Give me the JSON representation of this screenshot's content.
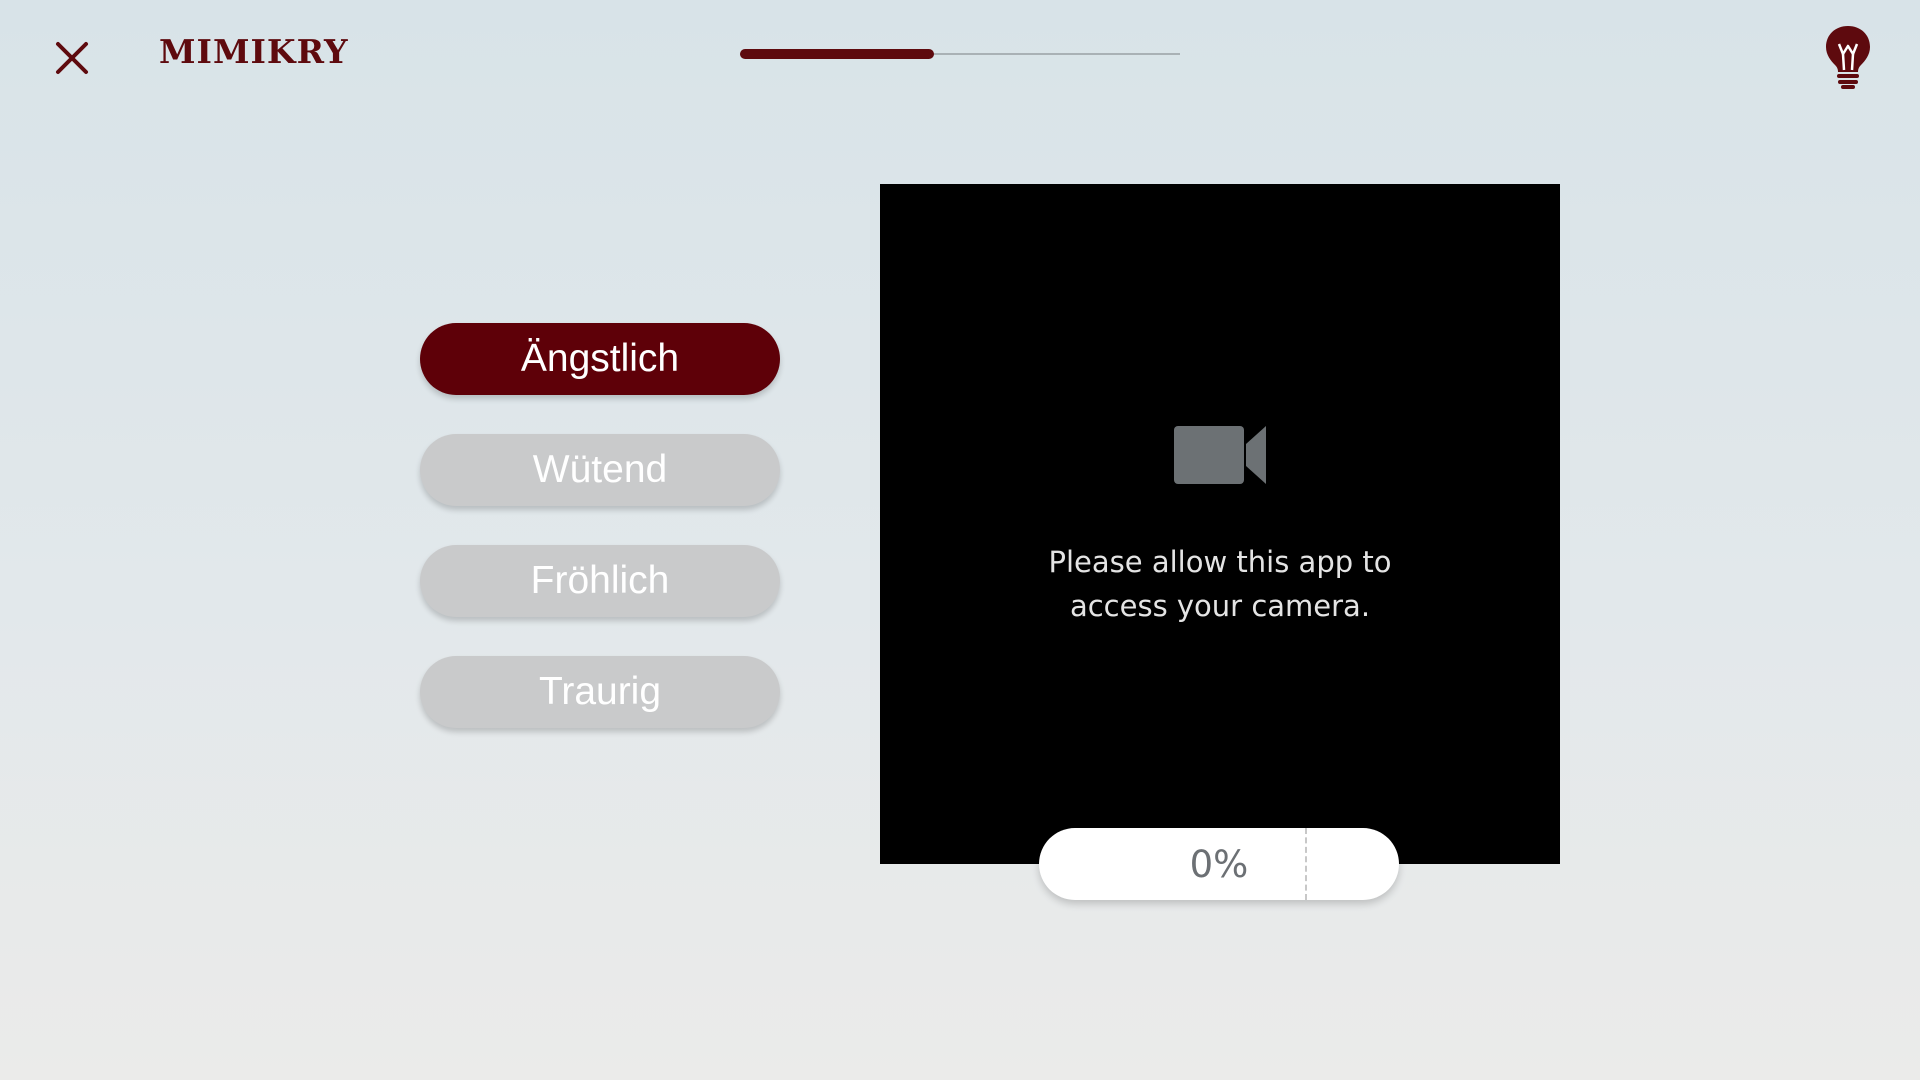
{
  "header": {
    "title": "MIMIKRY",
    "close_icon": "close-icon",
    "hint_icon": "lightbulb-icon",
    "progress": 0.44,
    "accent_color": "#5e0a0e"
  },
  "emotions": [
    {
      "label": "Ängstlich",
      "selected": true
    },
    {
      "label": "Wütend",
      "selected": false
    },
    {
      "label": "Fröhlich",
      "selected": false
    },
    {
      "label": "Traurig",
      "selected": false
    }
  ],
  "camera": {
    "icon": "video-camera-icon",
    "message_line1": "Please allow this app to",
    "message_line2": "access your camera."
  },
  "score": {
    "value": "0%"
  }
}
